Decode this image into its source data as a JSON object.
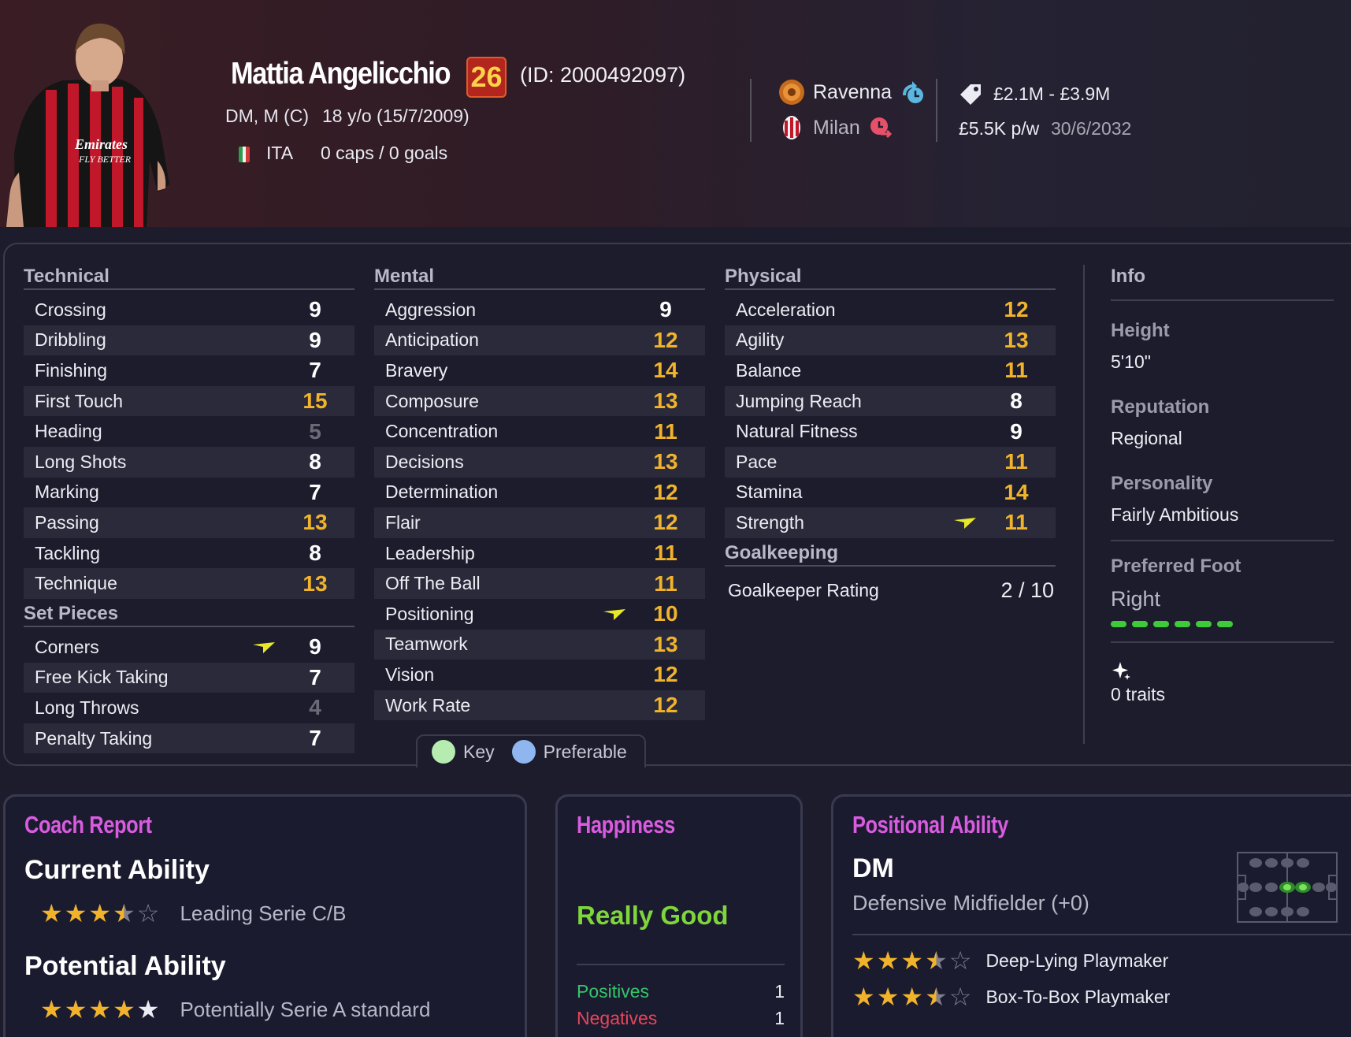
{
  "player": {
    "name": "Mattia Angelicchio",
    "ca_badge": "26",
    "id": "(ID: 2000492097)",
    "positions": "DM, M (C)",
    "age": "18 y/o (15/7/2009)",
    "nationality": "ITA",
    "caps": "0 caps / 0 goals"
  },
  "clubs": {
    "current": "Ravenna",
    "parent": "Milan"
  },
  "contract": {
    "value": "£2.1M - £3.9M",
    "wage": "£5.5K p/w",
    "expiry": "30/6/2032"
  },
  "technical": {
    "title": "Technical",
    "rows": [
      {
        "label": "Crossing",
        "value": "9"
      },
      {
        "label": "Dribbling",
        "value": "9"
      },
      {
        "label": "Finishing",
        "value": "7"
      },
      {
        "label": "First Touch",
        "value": "15"
      },
      {
        "label": "Heading",
        "value": "5"
      },
      {
        "label": "Long Shots",
        "value": "8"
      },
      {
        "label": "Marking",
        "value": "7"
      },
      {
        "label": "Passing",
        "value": "13"
      },
      {
        "label": "Tackling",
        "value": "8"
      },
      {
        "label": "Technique",
        "value": "13"
      }
    ]
  },
  "set_pieces": {
    "title": "Set Pieces",
    "rows": [
      {
        "label": "Corners",
        "value": "9"
      },
      {
        "label": "Free Kick Taking",
        "value": "7"
      },
      {
        "label": "Long Throws",
        "value": "4"
      },
      {
        "label": "Penalty Taking",
        "value": "7"
      }
    ]
  },
  "mental": {
    "title": "Mental",
    "rows": [
      {
        "label": "Aggression",
        "value": "9"
      },
      {
        "label": "Anticipation",
        "value": "12"
      },
      {
        "label": "Bravery",
        "value": "14"
      },
      {
        "label": "Composure",
        "value": "13"
      },
      {
        "label": "Concentration",
        "value": "11"
      },
      {
        "label": "Decisions",
        "value": "13"
      },
      {
        "label": "Determination",
        "value": "12"
      },
      {
        "label": "Flair",
        "value": "12"
      },
      {
        "label": "Leadership",
        "value": "11"
      },
      {
        "label": "Off The Ball",
        "value": "11"
      },
      {
        "label": "Positioning",
        "value": "10"
      },
      {
        "label": "Teamwork",
        "value": "13"
      },
      {
        "label": "Vision",
        "value": "12"
      },
      {
        "label": "Work Rate",
        "value": "12"
      }
    ]
  },
  "physical": {
    "title": "Physical",
    "rows": [
      {
        "label": "Acceleration",
        "value": "12"
      },
      {
        "label": "Agility",
        "value": "13"
      },
      {
        "label": "Balance",
        "value": "11"
      },
      {
        "label": "Jumping Reach",
        "value": "8"
      },
      {
        "label": "Natural Fitness",
        "value": "9"
      },
      {
        "label": "Pace",
        "value": "11"
      },
      {
        "label": "Stamina",
        "value": "14"
      },
      {
        "label": "Strength",
        "value": "11"
      }
    ]
  },
  "goalkeeping": {
    "title": "Goalkeeping",
    "label": "Goalkeeper Rating",
    "value": "2 / 10"
  },
  "legend": {
    "key": "Key",
    "preferable": "Preferable"
  },
  "info": {
    "title": "Info",
    "height_label": "Height",
    "height": "5'10\"",
    "reputation_label": "Reputation",
    "reputation": "Regional",
    "personality_label": "Personality",
    "personality": "Fairly Ambitious",
    "foot_label": "Preferred Foot",
    "foot": "Right",
    "traits": "0 traits"
  },
  "coach_report": {
    "title": "Coach Report",
    "current_label": "Current Ability",
    "current_stars": 3.5,
    "current_text": "Leading Serie C/B",
    "potential_label": "Potential Ability",
    "potential_stars": 5,
    "potential_text": "Potentially Serie A standard"
  },
  "happiness": {
    "title": "Happiness",
    "status": "Really Good",
    "positives_label": "Positives",
    "positives": "1",
    "negatives_label": "Negatives",
    "negatives": "1"
  },
  "positional": {
    "title": "Positional Ability",
    "position": "DM",
    "position_desc": "Defensive Midfielder (+0)",
    "roles": [
      {
        "name": "Deep-Lying Playmaker",
        "stars": 3.5
      },
      {
        "name": "Box-To-Box Playmaker",
        "stars": 3.5
      }
    ]
  },
  "colors": {
    "high": "#f0b32b",
    "mid": "#ffffff",
    "low": "#6b6b78",
    "accent": "#d95ce0",
    "happy": "#7ed63a",
    "positive": "#35c46a",
    "negative": "#e8455a"
  }
}
